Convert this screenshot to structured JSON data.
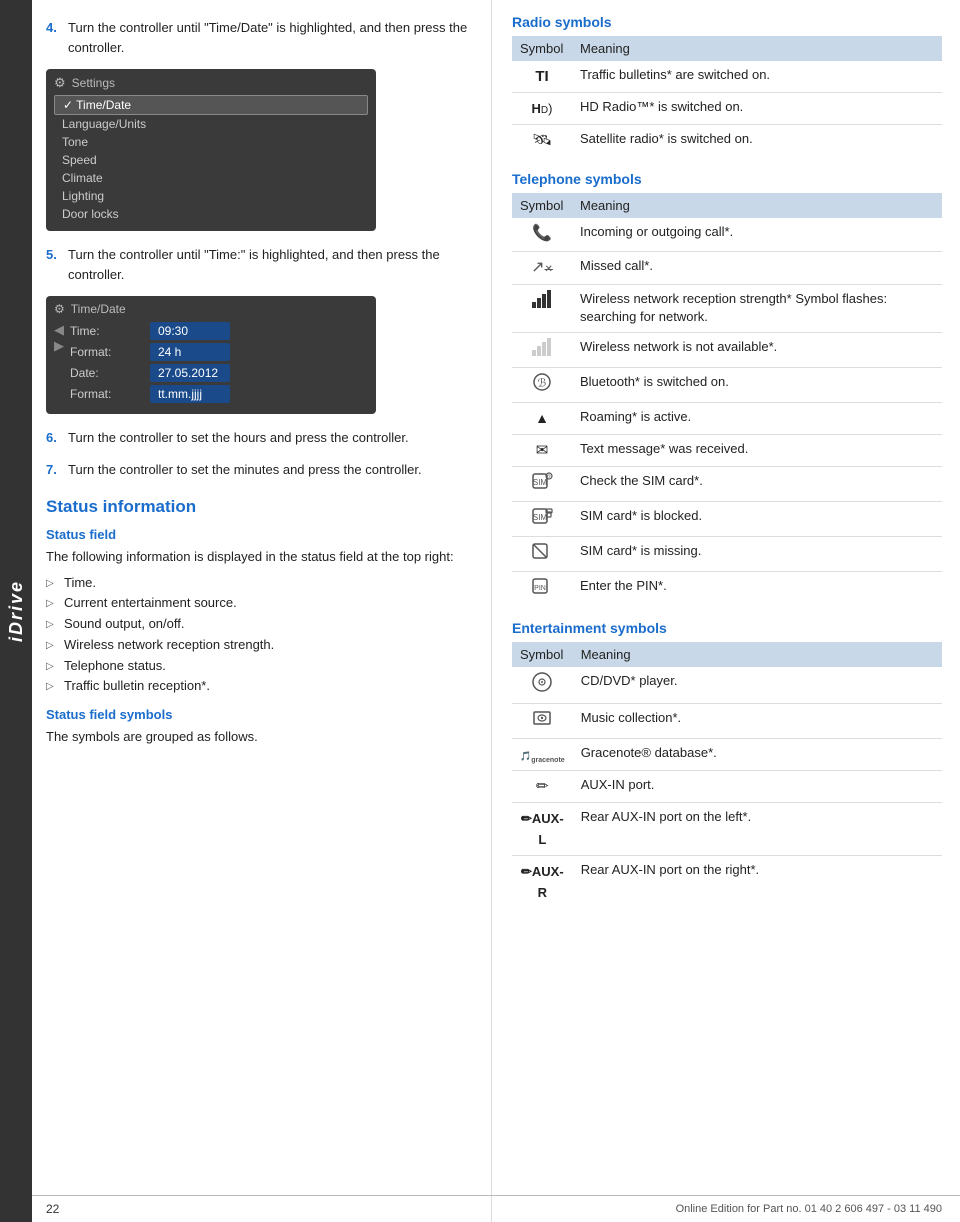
{
  "idrive_label": "iDrive",
  "steps": [
    {
      "num": "4.",
      "text": "Turn the controller until \"Time/Date\" is highlighted, and then press the controller."
    },
    {
      "num": "5.",
      "text": "Turn the controller until \"Time:\" is highlighted, and then press the controller."
    },
    {
      "num": "6.",
      "text": "Turn the controller to set the hours and press the controller."
    },
    {
      "num": "7.",
      "text": "Turn the controller to set the minutes and press the controller."
    }
  ],
  "screen1": {
    "title": "Settings",
    "items": [
      "Time/Date",
      "Language/Units",
      "Tone",
      "Speed",
      "Climate",
      "Lighting",
      "Door locks"
    ],
    "selected": "Time/Date"
  },
  "screen2": {
    "title": "Time/Date",
    "rows": [
      {
        "label": "Time:",
        "value": "09:30"
      },
      {
        "label": "Format:",
        "value": "24 h"
      },
      {
        "label": "Date:",
        "value": "27.05.2012"
      },
      {
        "label": "Format:",
        "value": "tt.mm.jjjj"
      }
    ]
  },
  "status_info": {
    "section_title": "Status information",
    "status_field_heading": "Status field",
    "status_field_body": "The following information is displayed in the status field at the top right:",
    "bullet_items": [
      "Time.",
      "Current entertainment source.",
      "Sound output, on/off.",
      "Wireless network reception strength.",
      "Telephone status.",
      "Traffic bulletin reception*."
    ],
    "status_field_symbols_heading": "Status field symbols",
    "status_field_symbols_body": "The symbols are grouped as follows."
  },
  "radio_symbols": {
    "heading": "Radio symbols",
    "col_symbol": "Symbol",
    "col_meaning": "Meaning",
    "rows": [
      {
        "symbol": "TI",
        "meaning": "Traffic bulletins* are switched on."
      },
      {
        "symbol": "HD)",
        "meaning": "HD Radio™* is switched on."
      },
      {
        "symbol": "🛰",
        "meaning": "Satellite radio* is switched on."
      }
    ]
  },
  "telephone_symbols": {
    "heading": "Telephone symbols",
    "col_symbol": "Symbol",
    "col_meaning": "Meaning",
    "rows": [
      {
        "symbol": "📞",
        "meaning": "Incoming or outgoing call*."
      },
      {
        "symbol": "↗",
        "meaning": "Missed call*."
      },
      {
        "symbol": "📶",
        "meaning": "Wireless network reception strength* Symbol flashes: searching for network."
      },
      {
        "symbol": "📶",
        "meaning": "Wireless network is not available*.",
        "variant": "low"
      },
      {
        "symbol": "🔵",
        "meaning": "Bluetooth* is switched on."
      },
      {
        "symbol": "▲",
        "meaning": "Roaming* is active."
      },
      {
        "symbol": "✉",
        "meaning": "Text message* was received."
      },
      {
        "symbol": "📋",
        "meaning": "Check the SIM card*."
      },
      {
        "symbol": "🔒",
        "meaning": "SIM card* is blocked."
      },
      {
        "symbol": "🚫",
        "meaning": "SIM card* is missing."
      },
      {
        "symbol": "🔢",
        "meaning": "Enter the PIN*."
      }
    ]
  },
  "entertainment_symbols": {
    "heading": "Entertainment symbols",
    "col_symbol": "Symbol",
    "col_meaning": "Meaning",
    "rows": [
      {
        "symbol": "⊙",
        "meaning": "CD/DVD* player."
      },
      {
        "symbol": "💿",
        "meaning": "Music collection*."
      },
      {
        "symbol": "gracenote",
        "meaning": "Gracenote® database*."
      },
      {
        "symbol": "✏",
        "meaning": "AUX-IN port."
      },
      {
        "symbol": "✏AUX-L",
        "meaning": "Rear AUX-IN port on the left*."
      },
      {
        "symbol": "✏AUX-R",
        "meaning": "Rear AUX-IN port on the right*."
      }
    ]
  },
  "footer": {
    "page_number": "22",
    "footer_text": "Online Edition for Part no. 01 40 2 606 497 - 03 11 490"
  }
}
